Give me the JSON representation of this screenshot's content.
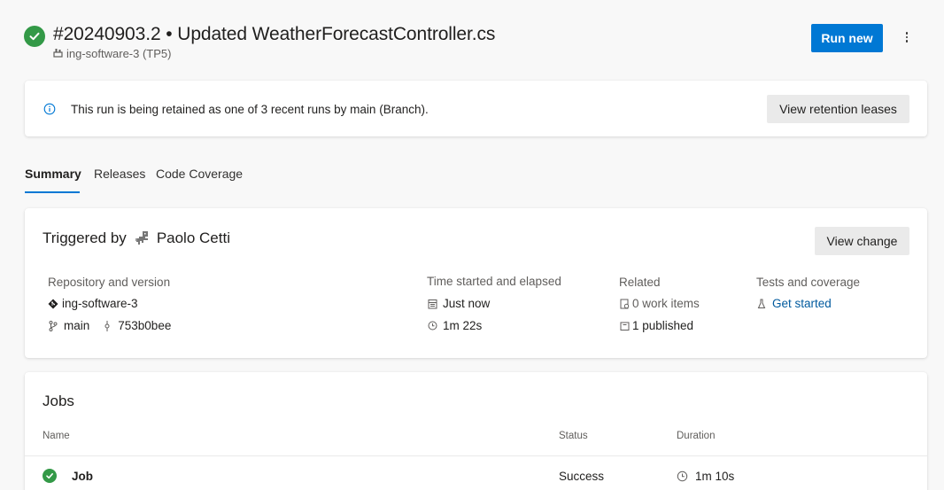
{
  "header": {
    "title": "#20240903.2 • Updated WeatherForecastController.cs",
    "pipeline": "ing-software-3 (TP5)",
    "status_color": "#339947",
    "run_new_label": "Run new",
    "more_icon": "more-vertical-icon"
  },
  "banner": {
    "icon": "info-icon",
    "message": "This run is being retained as one of 3 recent runs by main (Branch).",
    "button_label": "View retention leases"
  },
  "tabs": [
    {
      "label": "Summary",
      "active": true
    },
    {
      "label": "Releases",
      "active": false
    },
    {
      "label": "Code Coverage",
      "active": false
    }
  ],
  "summary": {
    "triggered_prefix": "Triggered by",
    "triggered_user": "Paolo Cetti",
    "view_change_label": "View change",
    "repository": {
      "heading": "Repository and version",
      "repo_name": "ing-software-3",
      "branch": "main",
      "commit": "753b0bee"
    },
    "time": {
      "heading": "Time started and elapsed",
      "started": "Just now",
      "elapsed": "1m 22s"
    },
    "related": {
      "heading": "Related",
      "work_items": "0 work items",
      "published": "1 published"
    },
    "tests": {
      "heading": "Tests and coverage",
      "link": "Get started"
    }
  },
  "jobs": {
    "title": "Jobs",
    "columns": [
      "Name",
      "Status",
      "Duration"
    ],
    "rows": [
      {
        "name": "Job",
        "status": "Success",
        "duration": "1m 10s"
      }
    ]
  },
  "colors": {
    "accent": "#0078d4",
    "success": "#339947",
    "link": "#005a9e"
  }
}
